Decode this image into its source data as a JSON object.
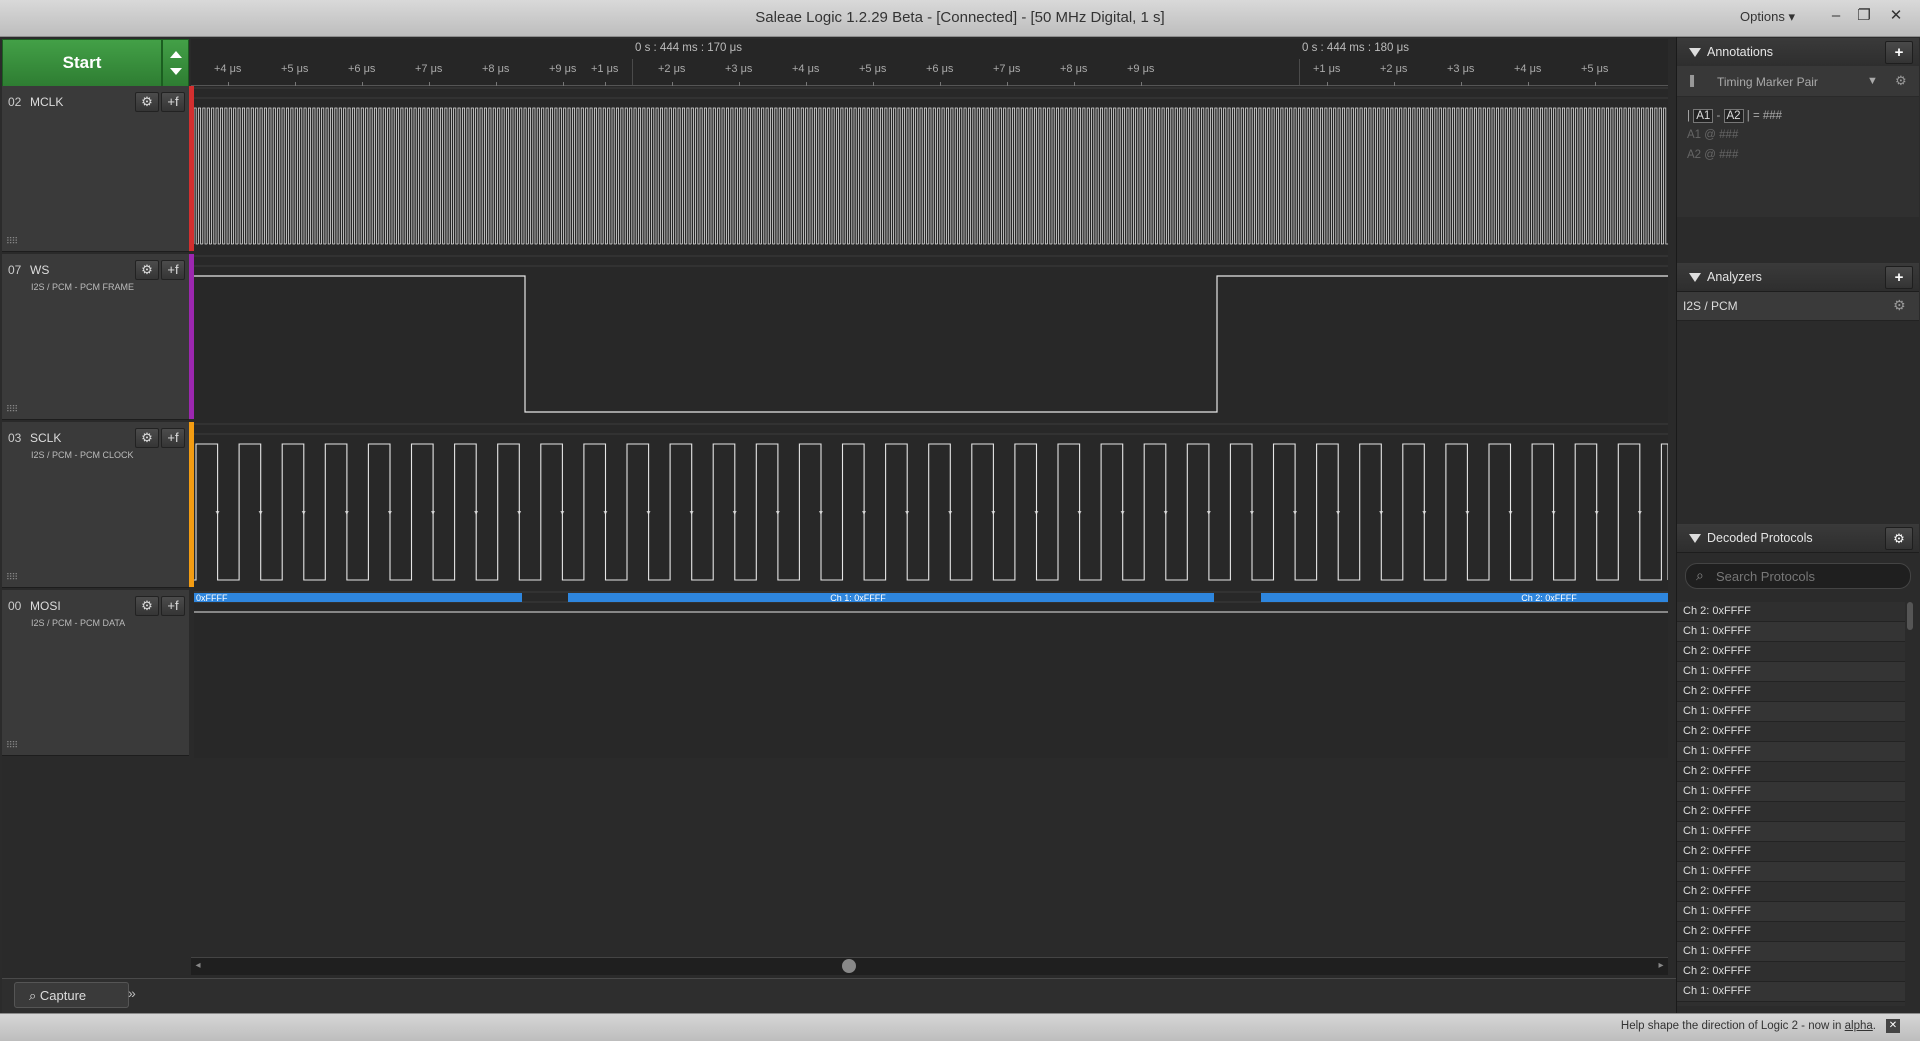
{
  "window": {
    "title": "Saleae Logic 1.2.29 Beta - [Connected] - [50 MHz Digital, 1 s]",
    "options_label": "Options ▾"
  },
  "controls": {
    "start_label": "Start"
  },
  "ruler": {
    "header_left": "0 s : 444 ms : 170 μs",
    "header_right": "0 s : 444 ms : 180 μs",
    "ticks_a": [
      "+4 μs",
      "+5 μs",
      "+6 μs",
      "+7 μs",
      "+8 μs",
      "+9 μs"
    ],
    "ticks_b": [
      "+1 μs",
      "+2 μs",
      "+3 μs",
      "+4 μs",
      "+5 μs",
      "+6 μs",
      "+7 μs",
      "+8 μs",
      "+9 μs"
    ],
    "ticks_c": [
      "+1 μs",
      "+2 μs",
      "+3 μs",
      "+4 μs",
      "+5 μs"
    ]
  },
  "channels": [
    {
      "num": "02",
      "name": "MCLK",
      "sub": "",
      "color": "#d32f2f"
    },
    {
      "num": "07",
      "name": "WS",
      "sub": "I2S / PCM - PCM FRAME",
      "color": "#9c27b0"
    },
    {
      "num": "03",
      "name": "SCLK",
      "sub": "I2S / PCM - PCM CLOCK",
      "color": "#f39c12"
    },
    {
      "num": "00",
      "name": "MOSI",
      "sub": "I2S / PCM - PCM DATA",
      "color": "#3a3a3a"
    }
  ],
  "decode_bubbles": [
    "0xFFFF",
    "Ch 1: 0xFFFF",
    "Ch 2: 0xFFFF"
  ],
  "tabs": {
    "capture": "Capture",
    "more": "»"
  },
  "annotations": {
    "title": "Annotations",
    "marker_pair": "Timing Marker Pair",
    "diff_a": "A1",
    "diff_b": "A2",
    "diff_value": "###",
    "a1_label": "A1",
    "a1_value": "###",
    "a2_label": "A2",
    "a2_value": "###"
  },
  "analyzers": {
    "title": "Analyzers",
    "items": [
      "I2S / PCM"
    ]
  },
  "decoded": {
    "title": "Decoded Protocols",
    "search_placeholder": "Search Protocols",
    "items": [
      "Ch 2: 0xFFFF",
      "Ch 1: 0xFFFF",
      "Ch 2: 0xFFFF",
      "Ch 1: 0xFFFF",
      "Ch 2: 0xFFFF",
      "Ch 1: 0xFFFF",
      "Ch 2: 0xFFFF",
      "Ch 1: 0xFFFF",
      "Ch 2: 0xFFFF",
      "Ch 1: 0xFFFF",
      "Ch 2: 0xFFFF",
      "Ch 1: 0xFFFF",
      "Ch 2: 0xFFFF",
      "Ch 1: 0xFFFF",
      "Ch 2: 0xFFFF",
      "Ch 1: 0xFFFF",
      "Ch 2: 0xFFFF",
      "Ch 1: 0xFFFF",
      "Ch 2: 0xFFFF",
      "Ch 1: 0xFFFF",
      "Ch 2: 0xFFFF"
    ]
  },
  "status": {
    "message": "Help shape the direction of Logic 2 - now in",
    "link": "alpha"
  },
  "colors": {
    "decode_bar": "#2e86de",
    "start_green": "#388e3c"
  }
}
